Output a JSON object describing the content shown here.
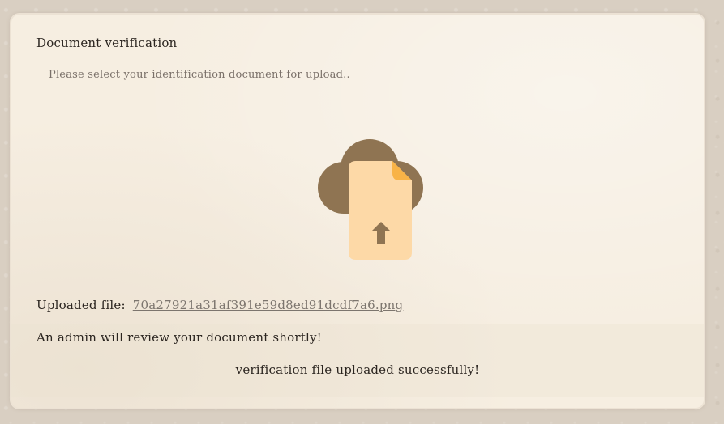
{
  "card": {
    "title": "Document verification",
    "subtitle": "Please select your identification document for upload..",
    "upload": {
      "icon": "cloud-upload-icon",
      "colors": {
        "cloud": "#8f7452",
        "file": "#fdd9a7",
        "fold": "#f8b347",
        "arrow": "#8f7452"
      }
    },
    "uploaded_label": "Uploaded file:",
    "uploaded_filename": "70a27921a31af391e59d8ed91dcdf7a6.png",
    "review_message": "An admin will review your document shortly!",
    "success_message": "verification file uploaded successfully!"
  }
}
